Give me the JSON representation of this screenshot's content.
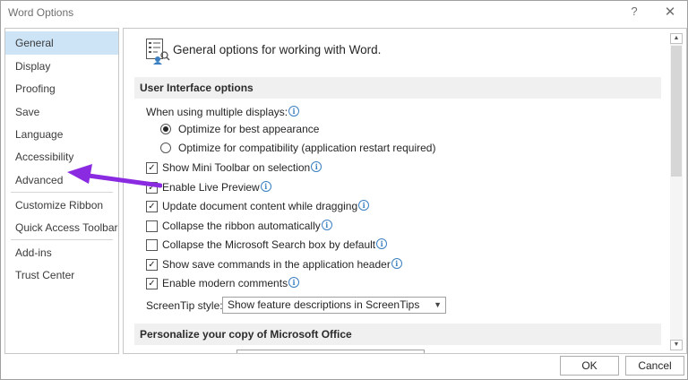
{
  "window": {
    "title": "Word Options",
    "help_glyph": "?",
    "close_glyph": "✕"
  },
  "nav": {
    "items": [
      {
        "label": "General",
        "selected": true
      },
      {
        "label": "Display"
      },
      {
        "label": "Proofing"
      },
      {
        "label": "Save"
      },
      {
        "label": "Language"
      },
      {
        "label": "Accessibility"
      },
      {
        "label": "Advanced"
      },
      {
        "label": "Customize Ribbon"
      },
      {
        "label": "Quick Access Toolbar"
      },
      {
        "label": "Add-ins"
      },
      {
        "label": "Trust Center"
      }
    ]
  },
  "main": {
    "header": "General options for working with Word.",
    "section_ui": "User Interface options",
    "multi_display_label": "When using multiple displays:",
    "radio_best": {
      "label": "Optimize for best appearance",
      "checked": true
    },
    "radio_compat": {
      "label": "Optimize for compatibility (application restart required)",
      "checked": false
    },
    "checks": [
      {
        "label": "Show Mini Toolbar on selection",
        "checked": true
      },
      {
        "label": "Enable Live Preview",
        "checked": true
      },
      {
        "label": "Update document content while dragging",
        "checked": true
      },
      {
        "label": "Collapse the ribbon automatically",
        "checked": false
      },
      {
        "label": "Collapse the Microsoft Search box by default",
        "checked": false
      },
      {
        "label": "Show save commands in the application header",
        "checked": true
      },
      {
        "label": "Enable modern comments",
        "checked": true
      }
    ],
    "screentip_label": "ScreenTip style:",
    "screentip_value": "Show feature descriptions in ScreenTips",
    "section_personalize": "Personalize your copy of Microsoft Office"
  },
  "buttons": {
    "ok": "OK",
    "cancel": "Cancel"
  },
  "icons": {
    "info": "i",
    "check": "✓",
    "dropdown": "▼",
    "scroll_up": "▲",
    "scroll_down": "▼"
  },
  "colors": {
    "selected_nav": "#cde4f7",
    "annotation_arrow": "#8a2be2",
    "info_icon": "#3a7fc1"
  }
}
